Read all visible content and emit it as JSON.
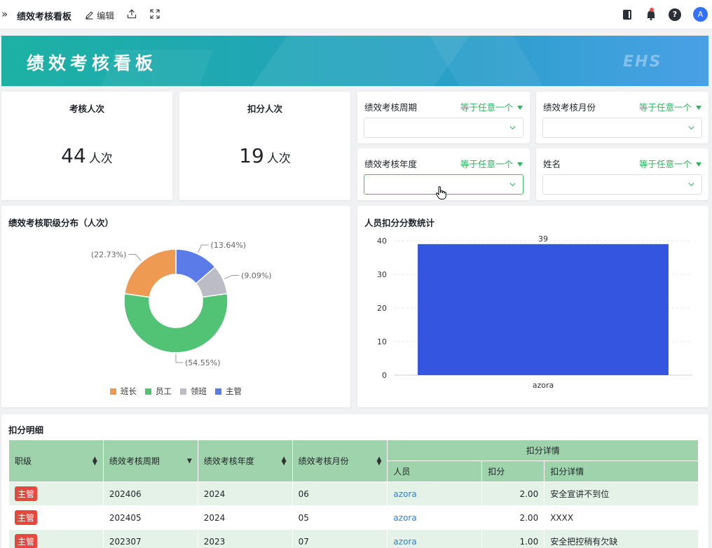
{
  "topbar": {
    "title": "绩效考核看板",
    "edit_label": "编辑",
    "avatar_letter": "A",
    "help_label": "?"
  },
  "banner": {
    "title": "绩效考核看板",
    "logo": "EHS"
  },
  "kpis": [
    {
      "title": "考核人次",
      "value": "44",
      "unit": "人次"
    },
    {
      "title": "扣分人次",
      "value": "19",
      "unit": "人次"
    }
  ],
  "filters": [
    {
      "label": "绩效考核周期",
      "operator": "等于任意一个",
      "value": ""
    },
    {
      "label": "绩效考核月份",
      "operator": "等于任意一个",
      "value": ""
    },
    {
      "label": "绩效考核年度",
      "operator": "等于任意一个",
      "value": ""
    },
    {
      "label": "姓名",
      "operator": "等于任意一个",
      "value": ""
    }
  ],
  "pie_card": {
    "title": "绩效考核职级分布（人次）"
  },
  "bar_card": {
    "title": "人员扣分分数统计"
  },
  "chart_data": [
    {
      "type": "pie",
      "title": "绩效考核职级分布（人次）",
      "donut": true,
      "slices": [
        {
          "name": "主管",
          "value": 13.64,
          "label": "(13.64%)",
          "color": "#5b7be9"
        },
        {
          "name": "领班",
          "value": 9.09,
          "label": "(9.09%)",
          "color": "#bcbcc6"
        },
        {
          "name": "员工",
          "value": 54.55,
          "label": "(54.55%)",
          "color": "#52c275"
        },
        {
          "name": "班长",
          "value": 22.73,
          "label": "(22.73%)",
          "color": "#ee9a52"
        }
      ],
      "legend": [
        "班长",
        "员工",
        "领班",
        "主管"
      ],
      "legend_position": "bottom"
    },
    {
      "type": "bar",
      "title": "人员扣分分数统计",
      "categories": [
        "azora"
      ],
      "values": [
        39
      ],
      "data_labels": [
        "39"
      ],
      "ylim": [
        0,
        40
      ],
      "yticks": [
        "0",
        "10",
        "20",
        "30",
        "40"
      ],
      "color": "#3355e0",
      "grid": true
    }
  ],
  "table": {
    "title": "扣分明细",
    "headers": {
      "level": "职级",
      "period": "绩效考核周期",
      "year": "绩效考核年度",
      "month": "绩效考核月份",
      "group": "扣分详情",
      "person": "人员",
      "score": "扣分",
      "detail": "扣分详情"
    },
    "rows": [
      {
        "level": "主管",
        "period": "202406",
        "year": "2024",
        "month": "06",
        "person": "azora",
        "score": "2.00",
        "detail": "安全宣讲不到位"
      },
      {
        "level": "主管",
        "period": "202405",
        "year": "2024",
        "month": "05",
        "person": "azora",
        "score": "2.00",
        "detail": "XXXX"
      },
      {
        "level": "主管",
        "period": "202307",
        "year": "2023",
        "month": "07",
        "person": "azora",
        "score": "1.00",
        "detail": "安全把控稍有欠缺"
      }
    ]
  }
}
